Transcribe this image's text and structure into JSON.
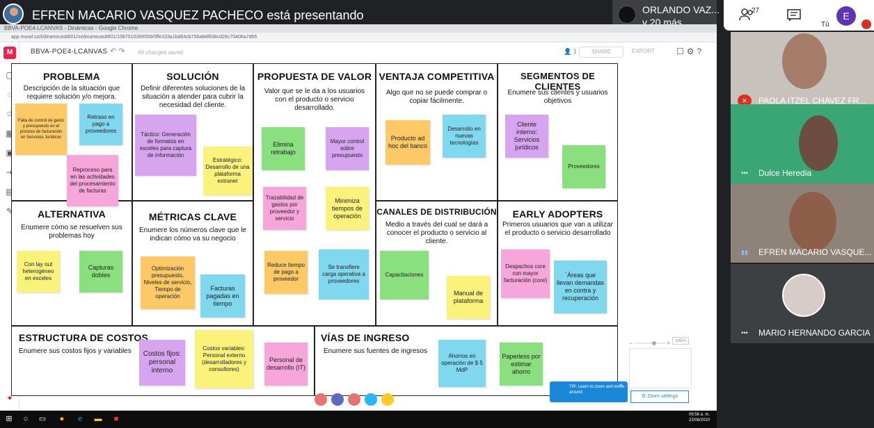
{
  "meet": {
    "presenting": "EFREN MACARIO VASQUEZ PACHECO está presentando",
    "other_presenter_name": "ORLANDO VAZ...",
    "other_presenter_more": "y 20 más",
    "people_count": "27",
    "me_initial": "E",
    "me_label": "Tú"
  },
  "browser": {
    "tab": "BBVA-POE4-LCANVAS - Dinámicas - Google Chrome",
    "url": "app.mural.co/t/dinamicas8601/m/dinamicas8601/1587510399059/0ffe103a1bd64cb756a84f838cd26c70406a7d65"
  },
  "mural": {
    "board_name": "BBVA-POE4-LCANVAS",
    "saved_status": "All changes saved",
    "users_count": "1",
    "share_label": "SHARE",
    "export_label": "EXPORT",
    "zoom_level": "145%",
    "tip_text": "TIP: Learn to zoom and move around",
    "zoom_settings_label": "Zoom settings"
  },
  "canvas": {
    "problema": {
      "title": "PROBLEMA",
      "desc": "Descripción de la situación que requiere solución y/o mejora."
    },
    "alternativa": {
      "title": "ALTERNATIVA",
      "desc": "Enumere cómo se resuelven sus problemas hoy"
    },
    "solucion": {
      "title": "SOLUCIÓN",
      "desc": "Definir diferentes soluciones de la situación a atender para cubrir la necesidad del cliente."
    },
    "metricas": {
      "title": "MÉTRICAS CLAVE",
      "desc": "Enumere los números clave que le indican cómo va su negocio"
    },
    "propuesta": {
      "title": "PROPUESTA DE VALOR",
      "desc": "Valor que se le da a los usuarios con el producto o servicio desarrollado."
    },
    "ventaja": {
      "title": "VENTAJA COMPETITIVA",
      "desc": "Algo que no se puede comprar o copiar fácilmente."
    },
    "canales": {
      "title": "CANALES DE DISTRIBUCIÓN",
      "desc": "Medio a través del cual se dará a conocer el producto o servicio al cliente."
    },
    "segmentos": {
      "title": "SEGMENTOS DE CLIENTES",
      "desc": "Enumere sus clientes y usuarios objetivos"
    },
    "early": {
      "title": "EARLY ADOPTERS",
      "desc": "Primeros usuarios que van a utilizar el producto o servicio desarrollado"
    },
    "costos": {
      "title": "ESTRUCTURA DE COSTOS",
      "desc": "Enumere sus costos fijos y variables"
    },
    "ingresos": {
      "title": "VÍAS DE INGRESO",
      "desc": "Enumere sus fuentes de ingresos"
    }
  },
  "stickies": {
    "p1": "Falta de control de gasto y presupuesto en el proceso de facturación en Servicios Jurídicos",
    "p2": "Retraso en pago a proveedores",
    "p3": "Reproceso para en las actividades del procesamiento de facturas",
    "a1": "Con lay out heterogéneo en exceles",
    "a2": "Capturas dobles",
    "s1": "Táctico: Generación de formatos en exceles para captura de información",
    "s2": "Estratégico: Desarrollo de una plataforma extranet",
    "m1": "Optimización presupuesto, Niveles de servicio, Tiempo de operación",
    "m2": "Facturas pagadas en tiempo",
    "v1": "Elimina retrabajo",
    "v2": "Mayor control sobre presupuesto",
    "v3": "Trazabilidad de gastos por proveedor y servicio",
    "v4": "Minimiza tiempos de operación",
    "v5": "Reduce tiempo de pago a proveedor",
    "v6": "Se transfiere carga operativa a proveedores",
    "c1": "Producto ad hoc del banco",
    "c2": "Desarrollo en nuevas tecnologías",
    "d1": "Capacitaciones",
    "d2": "Manual de plataforma",
    "g1": "Cliente interno: Servicios jurídicos",
    "g2": "Proveedores",
    "e1": "Despachos core con mayor facturación (core)",
    "e2": "´Áreas que llevan demandas en contra y recuperación",
    "k1": "Costos fijos: personal interno",
    "k2": "Costos variables: Personal externo (desarrolladores y consultores)",
    "k3": "Personal de desarrollo (IT)",
    "i1": "Ahorros en operación de $ 5 MdP",
    "i2": "Paperless por estimar ahorro"
  },
  "participants": [
    {
      "name": "PAOLA ITZEL CHAVEZ FR..."
    },
    {
      "name": "Dulce Heredia"
    },
    {
      "name": "EFREN MACARIO VASQUE..."
    },
    {
      "name": "MARIO HERNANDO GARCIA"
    }
  ],
  "taskbar": {
    "time": "09:58 a. m.",
    "date": "22/08/2020"
  },
  "colors": {
    "orange": "#fcc966",
    "blue": "#7fd8ee",
    "pink": "#f7a6dc",
    "purple": "#d7a4f0",
    "green": "#8ae07e",
    "yellow": "#fbf27b",
    "mural_brand": "#e8244f"
  }
}
